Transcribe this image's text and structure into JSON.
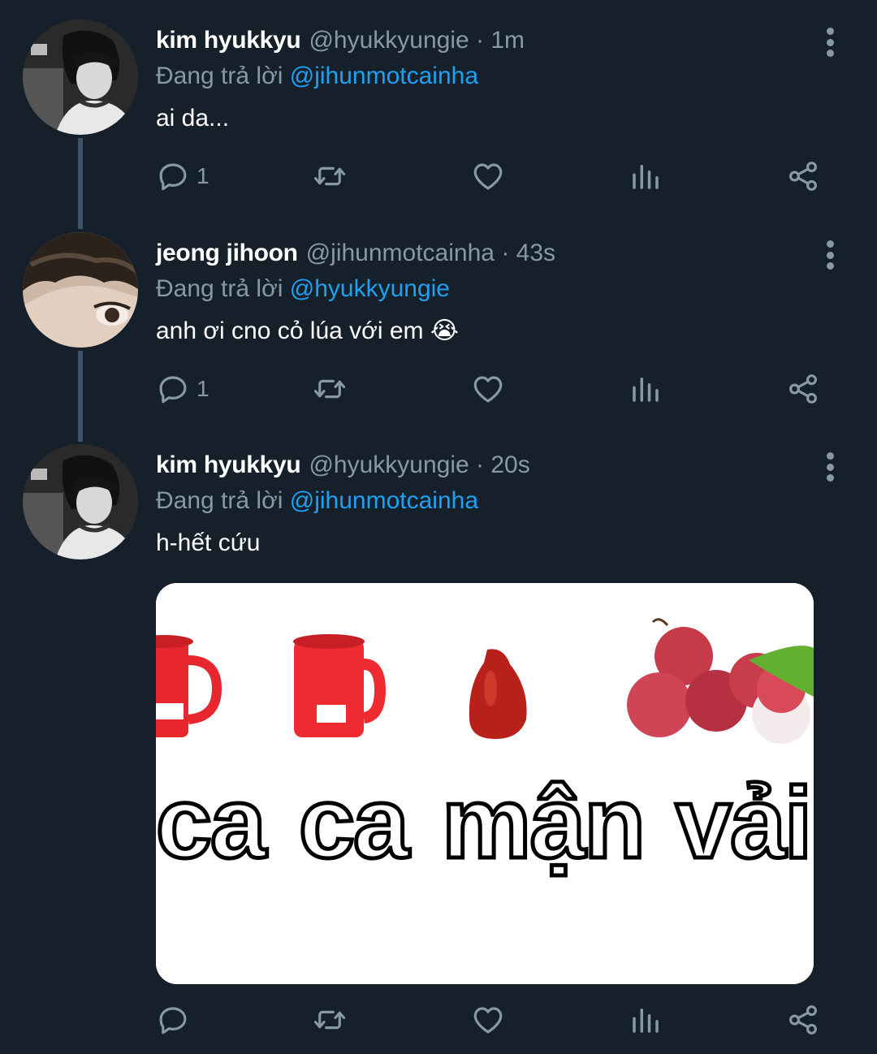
{
  "tweets": [
    {
      "name": "kim hyukkyu",
      "handle": "@hyukkyungie",
      "time": "· 1m",
      "replying_prefix": "Đang trả lời",
      "replying_to": "@jihunmotcainha",
      "text": "ai da...",
      "reply_count": "1"
    },
    {
      "name": "jeong jihoon",
      "handle": "@jihunmotcainha",
      "time": "· 43s",
      "replying_prefix": "Đang trả lời",
      "replying_to": "@hyukkyungie",
      "text": "anh ơi cno cỏ lúa với em",
      "emoji": "😭",
      "reply_count": "1"
    },
    {
      "name": "kim hyukkyu",
      "handle": "@hyukkyungie",
      "time": "· 20s",
      "replying_prefix": "Đang trả lời",
      "replying_to": "@jihunmotcainha",
      "text": "h-hết cứu",
      "reply_count": ""
    }
  ],
  "media": {
    "words": [
      "ca",
      "ca",
      "mận",
      "vải"
    ],
    "mug_label": "Mug Cup"
  },
  "icons": {
    "reply": "reply-icon",
    "retweet": "retweet-icon",
    "like": "heart-icon",
    "analytics": "analytics-icon",
    "share": "share-icon",
    "more": "more-vertical-icon"
  },
  "colors": {
    "background": "#15202b",
    "secondary_text": "#8899a6",
    "mention": "#1da1f2",
    "thread_line": "#3d5466"
  }
}
